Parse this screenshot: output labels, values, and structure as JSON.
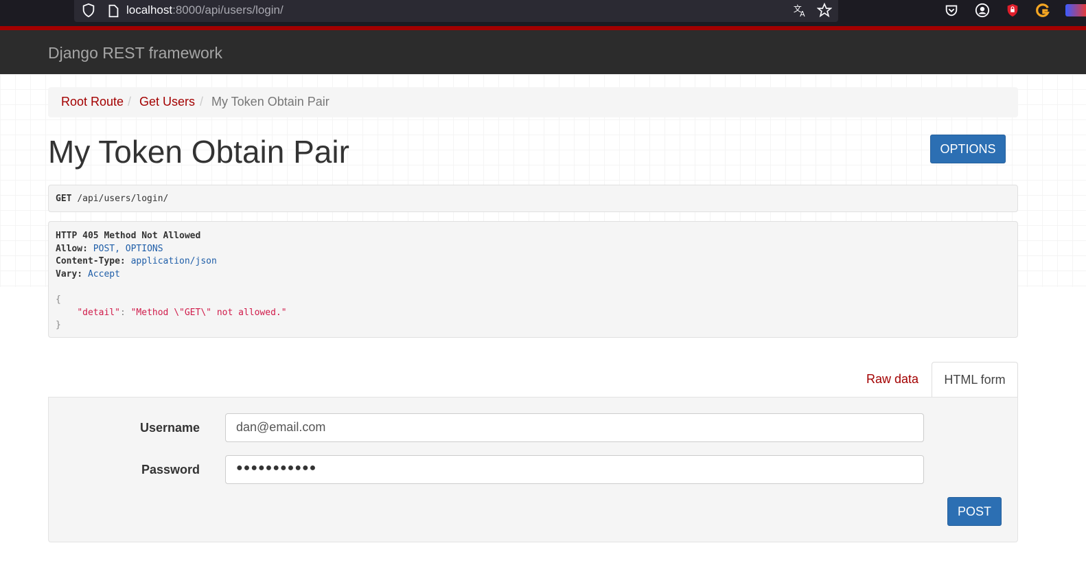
{
  "browser": {
    "url_host": "localhost",
    "url_rest": ":8000/api/users/login/"
  },
  "navbar": {
    "brand": "Django REST framework"
  },
  "breadcrumb": {
    "items": [
      {
        "label": "Root Route"
      },
      {
        "label": "Get Users"
      },
      {
        "label": "My Token Obtain Pair"
      }
    ],
    "separator": "/"
  },
  "page": {
    "title": "My Token Obtain Pair",
    "options_label": "OPTIONS"
  },
  "request": {
    "method": "GET",
    "path": "/api/users/login/"
  },
  "response": {
    "status": "HTTP 405 Method Not Allowed",
    "allow_key": "Allow:",
    "allow_value": "POST, OPTIONS",
    "ctype_key": "Content-Type:",
    "ctype_value": "application/json",
    "vary_key": "Vary:",
    "vary_value": "Accept",
    "brace_open": "{",
    "detail_key": "\"detail\"",
    "colon": ":",
    "detail_value": "\"Method \\\"GET\\\" not allowed.\"",
    "brace_close": "}"
  },
  "tabs": {
    "raw": "Raw data",
    "html": "HTML form"
  },
  "form": {
    "username_label": "Username",
    "username_value": "dan@email.com",
    "password_label": "Password",
    "password_value": "●●●●●●●●●●●",
    "post_label": "POST"
  },
  "colors": {
    "accent_red": "#a30000",
    "button_blue": "#2c6fb3",
    "navbar": "#2c2c2c"
  }
}
